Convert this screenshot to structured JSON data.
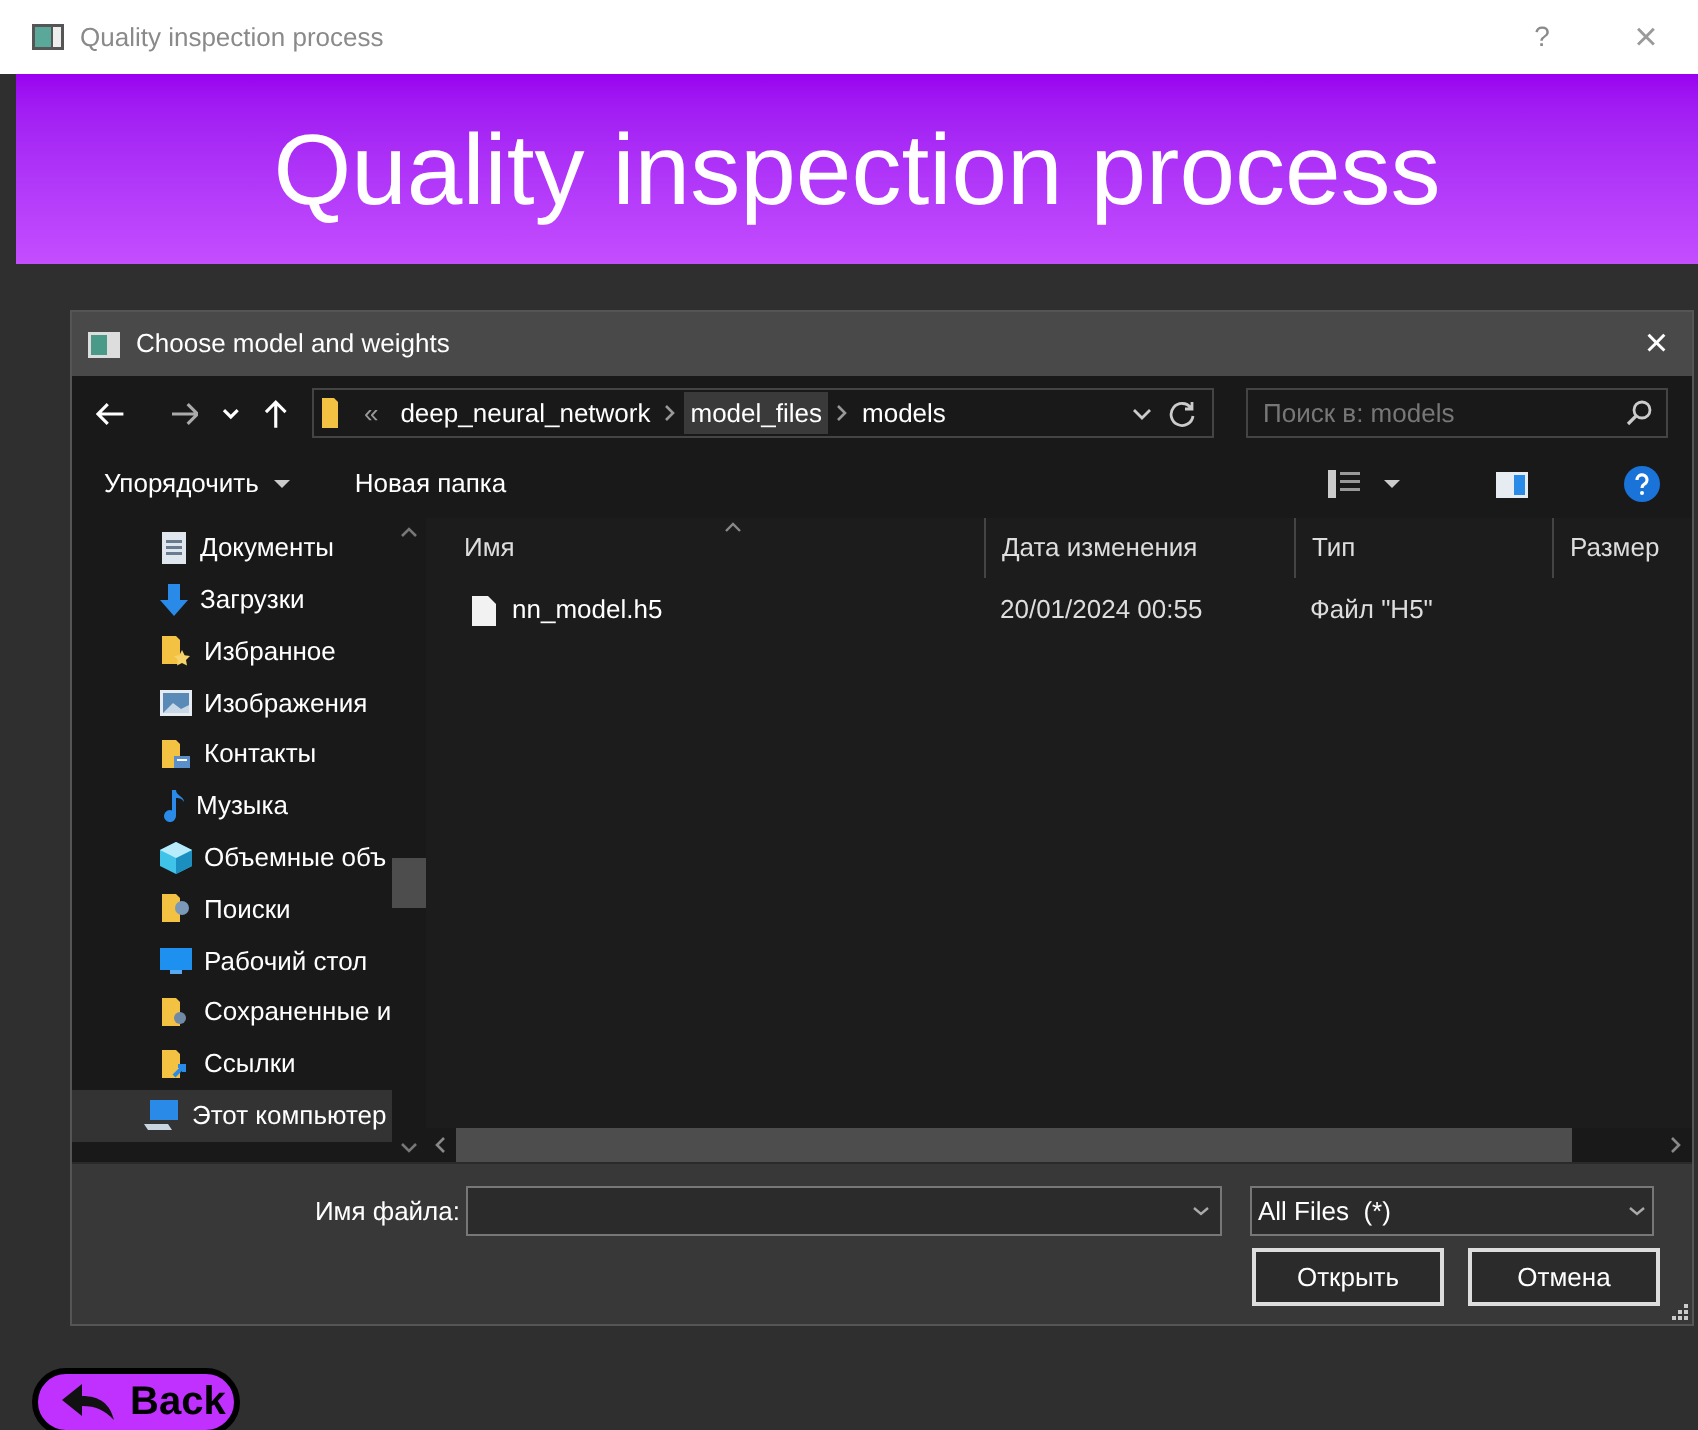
{
  "window": {
    "title": "Quality inspection process",
    "help": "?",
    "close": "×"
  },
  "banner": {
    "title": "Quality inspection process"
  },
  "dialog": {
    "title": "Choose model and weights",
    "breadcrumb": [
      {
        "label": "«",
        "kind": "overflow",
        "selected": false
      },
      {
        "label": "deep_neural_network",
        "kind": "folder",
        "selected": false
      },
      {
        "label": "model_files",
        "kind": "folder",
        "selected": true
      },
      {
        "label": "models",
        "kind": "folder",
        "selected": false
      }
    ],
    "search": {
      "placeholder": "Поиск в: models"
    },
    "toolbar": {
      "organize": "Упорядочить",
      "new_folder": "Новая папка"
    },
    "sidebar": {
      "items": [
        {
          "label": "Документы",
          "kind": "document",
          "selected": false
        },
        {
          "label": "Загрузки",
          "kind": "download",
          "selected": false
        },
        {
          "label": "Избранное",
          "kind": "star-folder",
          "selected": false
        },
        {
          "label": "Изображения",
          "kind": "image",
          "selected": false
        },
        {
          "label": "Контакты",
          "kind": "contacts",
          "selected": false
        },
        {
          "label": "Музыка",
          "kind": "music",
          "selected": false
        },
        {
          "label": "Объемные объ",
          "kind": "cube",
          "selected": false
        },
        {
          "label": "Поиски",
          "kind": "search-folder",
          "selected": false
        },
        {
          "label": "Рабочий стол",
          "kind": "desktop",
          "selected": false
        },
        {
          "label": "Сохраненные и",
          "kind": "saved-folder",
          "selected": false
        },
        {
          "label": "Ссылки",
          "kind": "link-folder",
          "selected": false
        },
        {
          "label": "Этот компьютер",
          "kind": "computer",
          "selected": true
        }
      ]
    },
    "table": {
      "columns": [
        "Имя",
        "Дата изменения",
        "Тип",
        "Размер"
      ],
      "rows": [
        {
          "name": "nn_model.h5",
          "modified": "20/01/2024 00:55",
          "type": "Файл \"H5\"",
          "selected": false
        }
      ]
    },
    "file_name_label": "Имя файла:",
    "filter": "All Files  (*)",
    "buttons": [
      "Открыть",
      "Отмена"
    ]
  },
  "back_button": "Back"
}
